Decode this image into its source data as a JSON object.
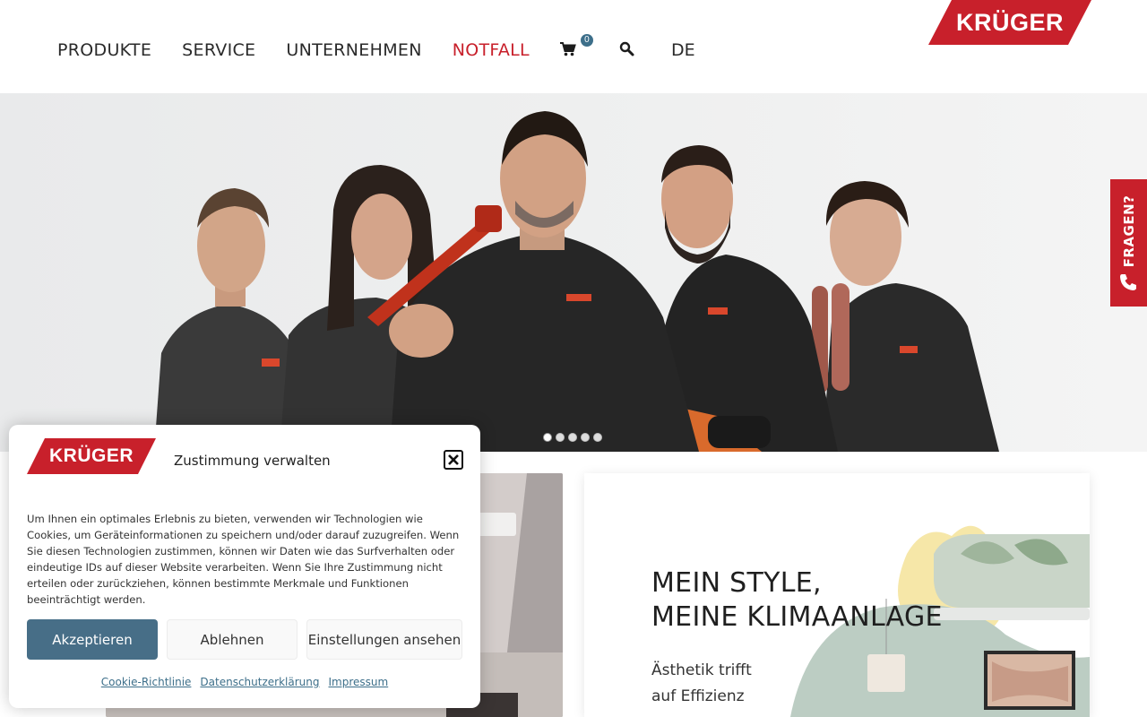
{
  "brand": {
    "logo_text": "KRÜGER",
    "accent": "#c8202b",
    "consent_primary": "#476e87"
  },
  "nav": {
    "items": [
      "PRODUKTE",
      "SERVICE",
      "UNTERNEHMEN",
      "NOTFALL"
    ],
    "cart_icon": "cart-icon",
    "cart_count": "0",
    "search_icon": "search-icon",
    "language": "DE"
  },
  "hero": {
    "slide_count": 5,
    "active_slide": 1
  },
  "side_tab": {
    "label": "FRAGEN?",
    "icon": "phone-icon"
  },
  "card": {
    "title_line1": "MEIN STYLE,",
    "title_line2": "MEINE KLIMAANLAGE",
    "subtitle_line1": "Ästhetik trifft",
    "subtitle_line2": "auf Effizienz"
  },
  "consent": {
    "title": "Zustimmung verwalten",
    "body": "Um Ihnen ein optimales Erlebnis zu bieten, verwenden wir Technologien wie Cookies, um Geräteinformationen zu speichern und/oder darauf zuzugreifen. Wenn Sie diesen Technologien zustimmen, können wir Daten wie das Surfverhalten oder eindeutige IDs auf dieser Website verarbeiten. Wenn Sie Ihre Zustimmung nicht erteilen oder zurückziehen, können bestimmte Merkmale und Funktionen beeinträchtigt werden.",
    "accept_label": "Akzeptieren",
    "deny_label": "Ablehnen",
    "settings_label": "Einstellungen ansehen",
    "links": [
      "Cookie-Richtlinie",
      "Datenschutzerklärung",
      "Impressum"
    ]
  }
}
